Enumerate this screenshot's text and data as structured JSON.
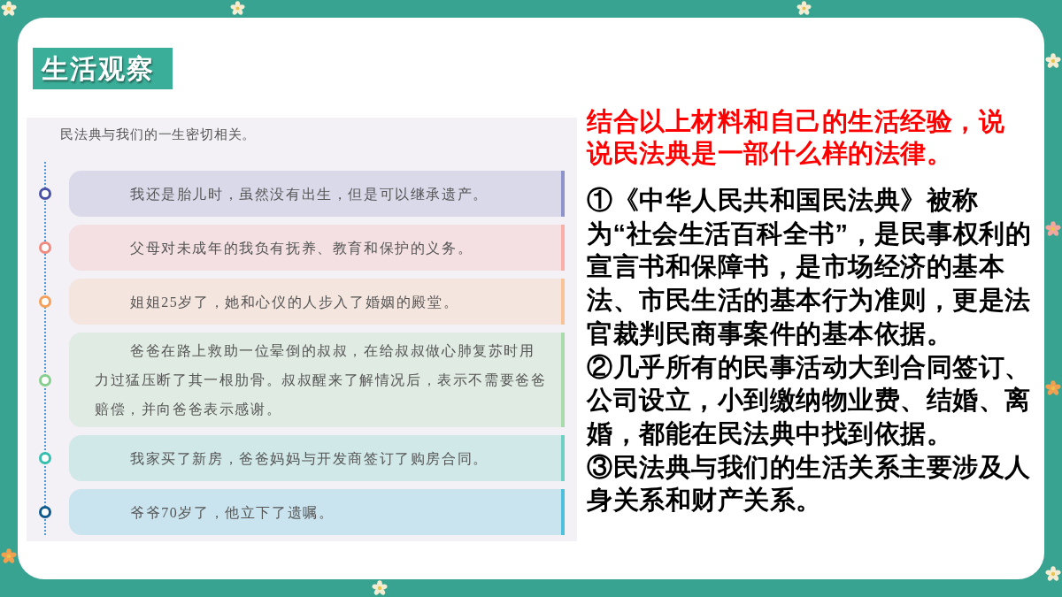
{
  "section_title": "生活观察",
  "material": {
    "heading": "民法典与我们的一生密切相关。",
    "items": [
      {
        "text": "我还是胎儿时，虽然没有出生，但是可以继承遗产。",
        "color": "#4a52a6",
        "card": {
          "color": "#8e93c9"
        }
      },
      {
        "text": "父母对未成年的我负有抚养、教育和保护的义务。",
        "color": "#f08a80",
        "card": {
          "color": "#f6b0a6"
        }
      },
      {
        "text": "姐姐25岁了，她和心仪的人步入了婚姻的殿堂。",
        "color": "#f5a05a",
        "card": {
          "color": "#f8c497"
        }
      },
      {
        "text": "爸爸在路上救助一位晕倒的叔叔，在给叔叔做心肺复苏时用力过猛压断了其一根肋骨。叔叔醒来了解情况后，表示不需要爸爸赔偿，并向爸爸表示感谢。",
        "color": "#86cf8e",
        "card": {
          "color": "#a8dbab"
        }
      },
      {
        "text": "我家买了新房，爸爸妈妈与开发商签订了购房合同。",
        "color": "#35bfae",
        "card": {
          "color": "#6dd0c2"
        }
      },
      {
        "text": "爷爷70岁了，他立下了遗嘱。",
        "color": "#0e5a8c",
        "card": {
          "color": "#4fc0dc"
        }
      }
    ]
  },
  "question": "结合以上材料和自己的生活经验，说说民法典是一部什么样的法律。",
  "answers": [
    "①《中华人民共和国民法典》被称为“社会生活百科全书”，是民事权利的宣言书和保障书，是市场经济的基本法、市民生活的基本行为准则，更是法官裁判民商事案件的基本依据。",
    "②几乎所有的民事活动大到合同签订、公司设立，小到缴纳物业费、结婚、离婚，都能在民法典中找到依据。",
    "③民法典与我们的生活关系主要涉及人身关系和财产关系。"
  ]
}
